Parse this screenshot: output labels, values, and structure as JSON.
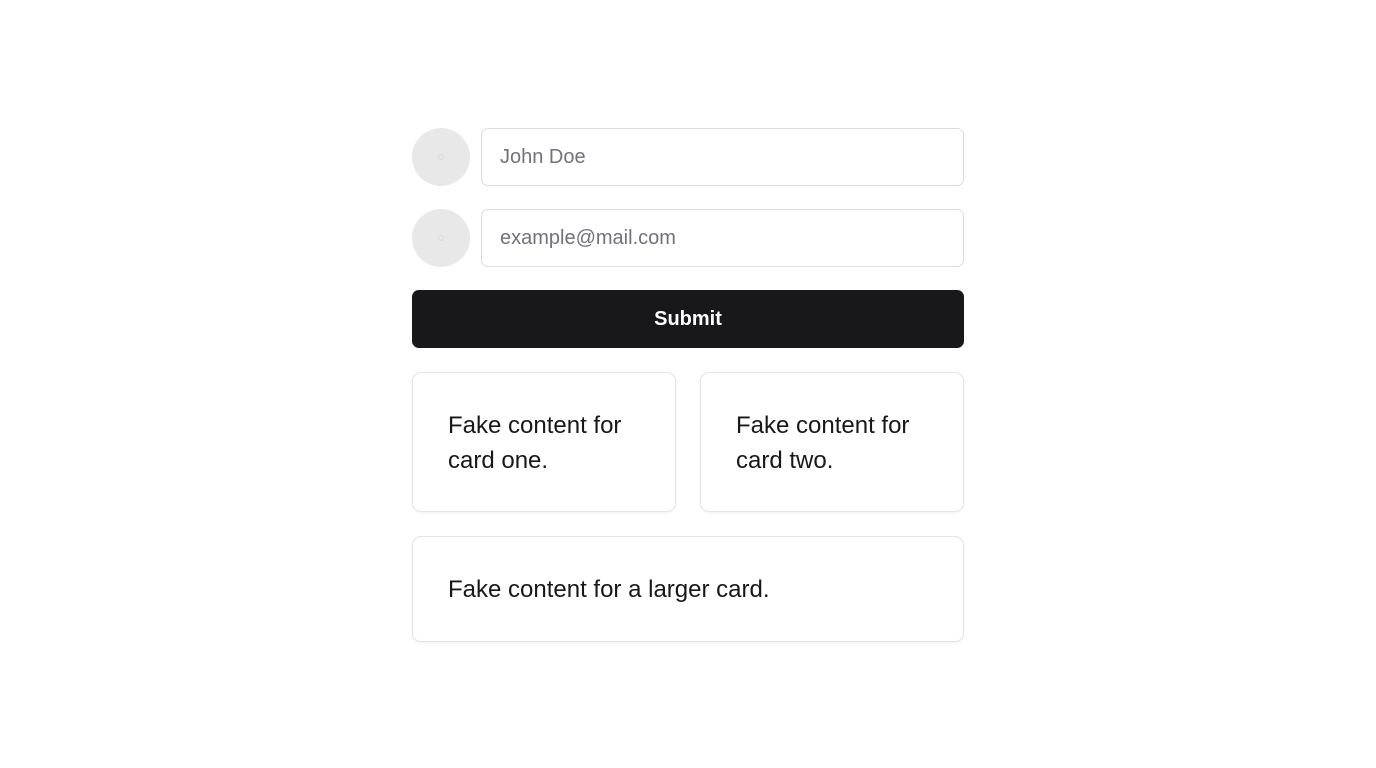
{
  "form": {
    "name_field": {
      "placeholder": "John Doe",
      "value": ""
    },
    "email_field": {
      "placeholder": "example@mail.com",
      "value": ""
    },
    "submit_label": "Submit"
  },
  "cards": {
    "card_one": "Fake content for card one.",
    "card_two": "Fake content for card two.",
    "card_large": "Fake content for a larger card."
  },
  "colors": {
    "button_bg": "#18181b",
    "avatar_bg": "#e8e8e8",
    "border": "#dcdce0"
  },
  "icons": {
    "name_avatar": "avatar-placeholder-icon",
    "email_avatar": "avatar-placeholder-icon"
  }
}
